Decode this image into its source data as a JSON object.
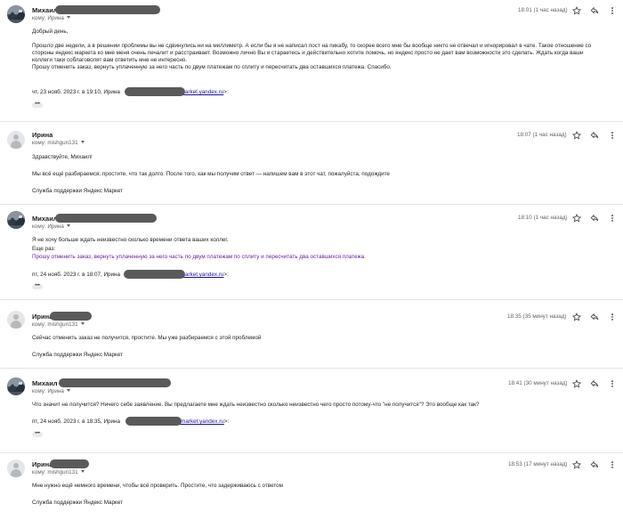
{
  "messages": [
    {
      "sender": "Михаил",
      "to_label": "кому: Ирина",
      "time": "18:01 (1 час назад)",
      "avatar": "photo-avatar",
      "lines": [
        "Добрый день,",
        "",
        "Прошло две недели, а в решении проблемы вы не сдвинулись ни на миллиметр. А если бы я не написал пост на пикабу, то скорее всего мне бы вообще никто не отвечал и игнорировал в чате. Такое отношение со",
        "стороны яндекс маркета ко мне меня очень печалит и расстраивает. Возможно лично Вы и стараетесь и действительно хотите помочь, но яндекс просто не дает вам возможности это сделать. Ждать когда ваши",
        "коллеги таки соблаговолят вам ответить мне не интересно.",
        "Прошу отменить заказ, вернуть уплаченную за него часть по двум платежам по сплиту и пересчитать два оставшихся платежа. Спасибо."
      ],
      "quote_prefix": "чт, 23 нояб. 2023 г. в 19:10, Ирина",
      "quote_email": "market.yandex.ru",
      "quote_suffix": ">:",
      "dots": "•••"
    },
    {
      "sender": "Ирина",
      "to_label": "кому: mishgun131",
      "time": "18:07 (1 час назад)",
      "avatar": "default-avatar",
      "lines": [
        "Здравствуйте, Михаил!",
        "",
        "Мы всё ещё разбираемся, простите, что так долго. После того, как мы получим ответ — напишем вам в этот чат, пожалуйста, подождите",
        "",
        "Служба поддержки Яндекс Маркет"
      ]
    },
    {
      "sender": "Михаил",
      "to_label": "кому: Ирина",
      "time": "18:10 (1 час назад)",
      "avatar": "photo-avatar",
      "lines": [
        "Я не хочу больше ждать неизвестно сколько времени ответа ваших коллег.",
        "Еще раз:"
      ],
      "quoted_line": "Прошу отменить заказ, вернуть уплаченную за него часть по двум платежам по сплиту и пересчитать два оставшихся платежа.",
      "quote_prefix": "пт, 24 нояб. 2023 г. в 18:07, Ирина",
      "quote_email": "market.yandex.ru",
      "quote_suffix": ">:",
      "dots": "•••"
    },
    {
      "sender": "Ирина",
      "to_label": "кому: mishgun131",
      "time": "18:35 (35 минут назад)",
      "avatar": "default-avatar",
      "lines": [
        "Сейчас отменить заказ не получится, простите. Мы уже разбираемся с этой проблемой",
        "",
        "Служба поддержки Яндекс Маркет"
      ]
    },
    {
      "sender": "Михаил",
      "to_label": "кому: Ирина",
      "time": "18:41 (30 минут назад)",
      "avatar": "photo-avatar",
      "lines": [
        "Что значит не получится? Ничего себе заявление. Вы предлагаете мне ждать неизвестно сколько неизвестно чего просто потому-что \"не получится\"? Это вообще как так?"
      ],
      "quote_prefix": "пт, 24 нояб. 2023 г. в 18:35, Ирина",
      "quote_email": "@market.yandex.ru",
      "quote_suffix": ">:",
      "dots": "•••"
    },
    {
      "sender": "Ирина",
      "to_label": "кому: mishgun131",
      "time": "18:53 (17 минут назад)",
      "avatar": "default-avatar",
      "lines": [
        "Мне нужно ещё немного времени, чтобы всё проверить. Простите, что задерживаюсь с ответом",
        "",
        "Служба поддержки Яндекс Маркет"
      ]
    }
  ]
}
